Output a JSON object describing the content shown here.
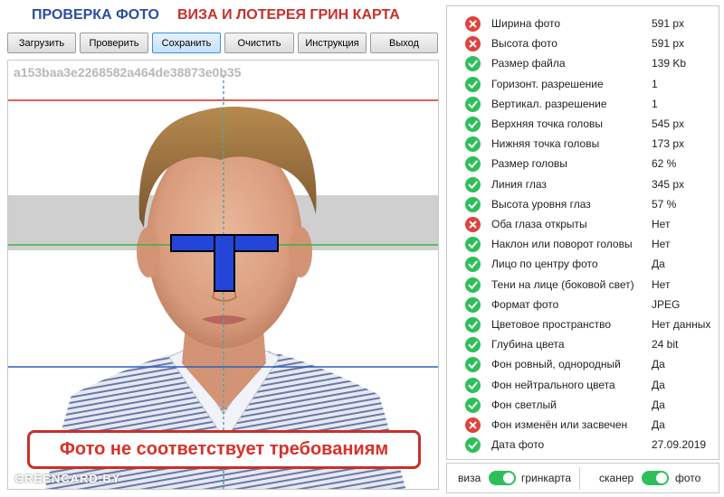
{
  "header": {
    "title_left": "ПРОВЕРКА ФОТО",
    "title_right": "ВИЗА И ЛОТЕРЕЯ ГРИН КАРТА"
  },
  "toolbar": [
    {
      "label": "Загрузить",
      "active": false
    },
    {
      "label": "Проверить",
      "active": false
    },
    {
      "label": "Сохранить",
      "active": true
    },
    {
      "label": "Очистить",
      "active": false
    },
    {
      "label": "Инструкция",
      "active": false
    },
    {
      "label": "Выход",
      "active": false
    }
  ],
  "photo": {
    "hash": "a153baa3e2268582a464de38873e0b35",
    "warning": "Фото не соответствует требованиям",
    "watermark": "GREENCARD.BY"
  },
  "checks": [
    {
      "label": "Ширина фото",
      "value": "591 px",
      "ok": false
    },
    {
      "label": "Высота фото",
      "value": "591 px",
      "ok": false
    },
    {
      "label": "Размер файла",
      "value": "139 Kb",
      "ok": true
    },
    {
      "label": "Горизонт. разрешение",
      "value": "1",
      "ok": true
    },
    {
      "label": "Вертикал. разрешение",
      "value": "1",
      "ok": true
    },
    {
      "label": "Верхняя точка головы",
      "value": "545 px",
      "ok": true
    },
    {
      "label": "Нижняя точка головы",
      "value": "173 px",
      "ok": true
    },
    {
      "label": "Размер головы",
      "value": "62 %",
      "ok": true
    },
    {
      "label": "Линия глаз",
      "value": "345 px",
      "ok": true
    },
    {
      "label": "Высота уровня глаз",
      "value": "57 %",
      "ok": true
    },
    {
      "label": "Оба глаза открыты",
      "value": "Нет",
      "ok": false
    },
    {
      "label": "Наклон или поворот головы",
      "value": "Нет",
      "ok": true
    },
    {
      "label": "Лицо по центру фото",
      "value": "Да",
      "ok": true
    },
    {
      "label": "Тени на лице (боковой свет)",
      "value": "Нет",
      "ok": true
    },
    {
      "label": "Формат фото",
      "value": "JPEG",
      "ok": true
    },
    {
      "label": "Цветовое пространство",
      "value": "Нет данных",
      "ok": true
    },
    {
      "label": "Глубина цвета",
      "value": "24 bit",
      "ok": true
    },
    {
      "label": "Фон ровный, однородный",
      "value": "Да",
      "ok": true
    },
    {
      "label": "Фон нейтрального цвета",
      "value": "Да",
      "ok": true
    },
    {
      "label": "Фон светлый",
      "value": "Да",
      "ok": true
    },
    {
      "label": "Фон изменён или засвечен",
      "value": "Да",
      "ok": false
    },
    {
      "label": "Дата фото",
      "value": "27.09.2019",
      "ok": true
    }
  ],
  "toggles": {
    "visa_label": "виза",
    "greencard_label": "гринкарта",
    "visa_greencard_on": true,
    "scanner_label": "сканер",
    "photo_label": "фото",
    "scanner_photo_on": true
  },
  "colors": {
    "ok": "#2fbf5a",
    "fail": "#e0423c",
    "accent_blue": "#2a4fa0",
    "accent_red": "#c8302a"
  }
}
